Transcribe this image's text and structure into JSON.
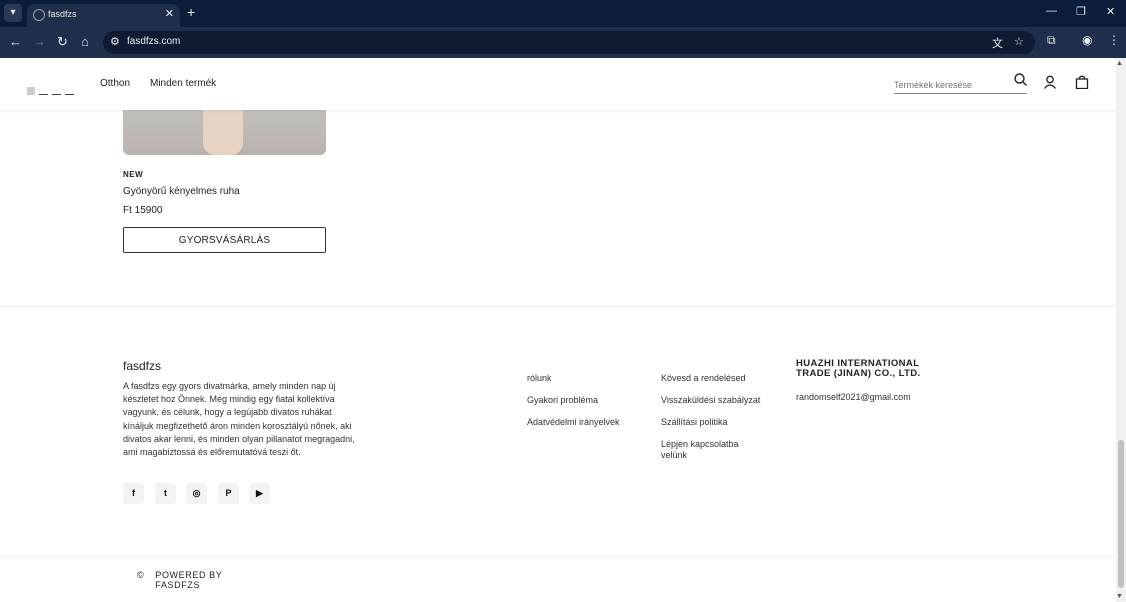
{
  "browser": {
    "tab_title": "fasdfzs",
    "url": "fasdfzs.com",
    "icons": {
      "tab_list": "chevron-down-icon",
      "tab_close": "close-icon",
      "new_tab": "plus-icon",
      "minimize": "minimize-icon",
      "restore": "restore-icon",
      "close_window": "close-icon",
      "back": "back-arrow-icon",
      "forward": "forward-arrow-icon",
      "reload": "reload-icon",
      "home": "home-icon",
      "site_info": "tune-icon",
      "translate": "translate-icon",
      "bookmark": "star-icon",
      "extensions": "puzzle-icon",
      "profile": "profile-icon",
      "menu": "kebab-menu-icon"
    }
  },
  "header": {
    "nav": [
      "Otthon",
      "Minden termék"
    ],
    "search_placeholder": "Termékek keresése",
    "icons": [
      "search-icon",
      "user-icon",
      "shopping-bag-icon"
    ]
  },
  "product": {
    "badge": "NEW",
    "name": "Gyönyörű kényelmes ruha",
    "price": "Ft 15900",
    "button_label": "GYORSVÁSÁRLÁS"
  },
  "footer": {
    "brand": "fasdfzs",
    "description": "A fasdfzs egy gyors divatmárka, amely minden nap új készletet hoz Önnek. Még mindig egy fiatal kollektíva vagyunk, és célunk, hogy a legújabb divatos ruhákat kínáljuk megfizethető áron minden korosztályú nőnek, aki divatos akar lenni, és minden olyan pillanatot megragadni, ami magabiztossá és előremutatóvá teszi őt.",
    "social": [
      "facebook-icon",
      "twitter-icon",
      "instagram-icon",
      "pinterest-icon",
      "youtube-icon"
    ],
    "links_col1": [
      "rólunk",
      "Gyakori probléma",
      "Adatvédelmi irányelvek"
    ],
    "links_col2": [
      "Kövesd a rendelésed",
      "Visszaküldési szabályzat",
      "Szállítási politika",
      "Lépjen kapcsolatba velünk"
    ],
    "company": "HUAZHI INTERNATIONAL TRADE (JINAN) CO., LTD.",
    "email": "randomself2021@gmail.com",
    "copyright_symbol": "©",
    "powered_by": "POWERED BY FASDFZS"
  },
  "colors": {
    "chrome_dark": "#0b1d3a",
    "chrome_toolbar": "#1f2e4a",
    "text": "#222222",
    "divider": "#eeeeee"
  }
}
